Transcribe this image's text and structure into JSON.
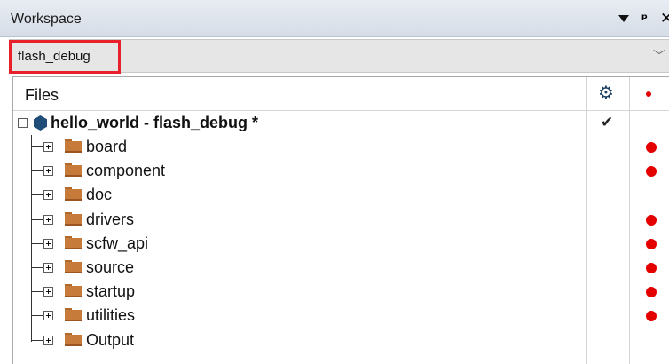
{
  "window": {
    "title": "Workspace",
    "icons": [
      "dropdown-arrow-icon",
      "pin-icon",
      "close-icon"
    ]
  },
  "config": {
    "selected": "flash_debug",
    "highlight_color": "#e8202a"
  },
  "tree": {
    "header": {
      "label": "Files",
      "options_icon": "gear-icon"
    },
    "root": {
      "label": "hello_world - flash_debug *",
      "expanded": true,
      "checked": true,
      "icon": "project-hexagon-icon"
    },
    "items": [
      {
        "label": "board",
        "has_dot": true
      },
      {
        "label": "component",
        "has_dot": true
      },
      {
        "label": "doc",
        "has_dot": false
      },
      {
        "label": "drivers",
        "has_dot": true
      },
      {
        "label": "scfw_api",
        "has_dot": true
      },
      {
        "label": "source",
        "has_dot": true
      },
      {
        "label": "startup",
        "has_dot": true
      },
      {
        "label": "utilities",
        "has_dot": true
      },
      {
        "label": "Output",
        "has_dot": false
      }
    ]
  },
  "colors": {
    "dot": "#e50000",
    "folder": "#c77b3a",
    "project": "#1f4d78",
    "gear": "#1d3f63"
  }
}
